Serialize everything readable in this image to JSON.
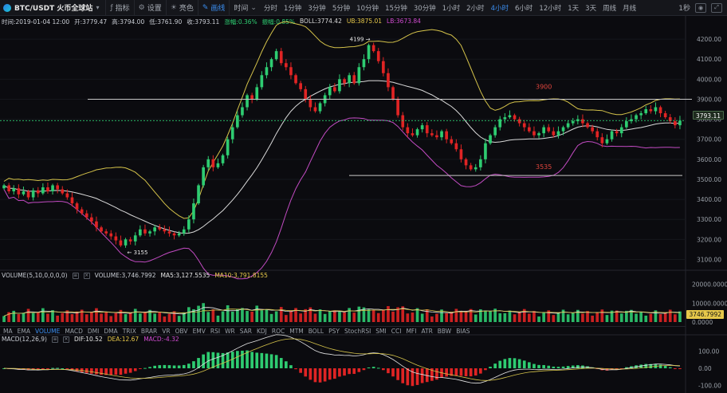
{
  "toolbar": {
    "pair": "BTC/USDT 火币全球站",
    "buttons": [
      {
        "label": "指标",
        "icon": "indicator-icon"
      },
      {
        "label": "设置",
        "icon": "gear-icon"
      },
      {
        "label": "亮色",
        "icon": "theme-icon"
      },
      {
        "label": "画线",
        "icon": "draw-line-icon",
        "active": true
      }
    ],
    "chart_type": "时间",
    "intervals": [
      "分时",
      "1分钟",
      "3分钟",
      "5分钟",
      "10分钟",
      "15分钟",
      "30分钟",
      "1小时",
      "2小时",
      "4小时",
      "6小时",
      "12小时",
      "1天",
      "3天",
      "周线",
      "月线"
    ],
    "active_interval": "4小时",
    "refresh": "1秒"
  },
  "ohlc": {
    "time": "时间:2019-01-04 12:00",
    "open": "开:3779.47",
    "high": "高:3794.00",
    "low": "低:3761.90",
    "close": "收:3793.11",
    "change": "涨幅:0.36%",
    "amp": "振幅:0.85%",
    "boll": "BOLL:3774.42",
    "ub": "UB:3875.01",
    "lb": "LB:3673.84"
  },
  "volume_legend": {
    "label": "VOLUME(5,10,0,0,0,0)",
    "vol": "VOLUME:3,746.7992",
    "ma5": "MA5:3,127.5535",
    "ma10": "MA10:3,791.8155"
  },
  "macd_legend": {
    "label": "MACD(12,26,9)",
    "dif": "DIF:10.52",
    "dea": "DEA:12.67",
    "macd": "MACD:-4.32"
  },
  "indicator_tabs": [
    "MA",
    "EMA",
    "VOLUME",
    "MACD",
    "DMI",
    "DMA",
    "TRIX",
    "BRAR",
    "VR",
    "OBV",
    "EMV",
    "RSI",
    "WR",
    "SAR",
    "KDJ",
    "ROC",
    "MTM",
    "BOLL",
    "PSY",
    "StochRSI",
    "SMI",
    "CCI",
    "MFI",
    "ATR",
    "BBW",
    "BIAS"
  ],
  "active_tab": "VOLUME",
  "price_axis": [
    "4200.00",
    "4100.00",
    "4000.00",
    "3900.00",
    "3800.00",
    "3700.00",
    "3600.00",
    "3500.00",
    "3400.00",
    "3300.00",
    "3200.00",
    "3100.00"
  ],
  "price_tag": "3793.11",
  "volume_axis": [
    "20000.0000",
    "10000.0000",
    "0.0000"
  ],
  "volume_tag": "3746.7992",
  "macd_axis": [
    "100.00",
    "0.00",
    "-100.00"
  ],
  "annotations": {
    "high_label": "4199",
    "low_label": "3155",
    "resistance_label": "3900",
    "support_label": "3535"
  },
  "colors": {
    "up": "#2ecc71",
    "down": "#e02424",
    "ub": "#d4c24a",
    "mid": "#d9d9d9",
    "lb": "#c24bc2",
    "accent": "#3b8ef0"
  },
  "chart_data": {
    "type": "candlestick",
    "symbol": "BTC/USDT",
    "interval": "4小时",
    "ylim": [
      3050,
      4260
    ],
    "closes": [
      3470,
      3440,
      3455,
      3425,
      3440,
      3410,
      3445,
      3430,
      3460,
      3440,
      3470,
      3450,
      3430,
      3410,
      3380,
      3350,
      3330,
      3310,
      3290,
      3260,
      3240,
      3230,
      3215,
      3195,
      3170,
      3200,
      3190,
      3220,
      3250,
      3230,
      3240,
      3260,
      3250,
      3240,
      3230,
      3220,
      3230,
      3250,
      3300,
      3380,
      3470,
      3560,
      3600,
      3560,
      3580,
      3620,
      3700,
      3760,
      3820,
      3860,
      3920,
      3900,
      3960,
      4020,
      4060,
      4100,
      4140,
      4080,
      4060,
      4020,
      3980,
      3950,
      3900,
      3860,
      3840,
      3880,
      3920,
      3960,
      3940,
      4000,
      3980,
      4020,
      3980,
      4060,
      4100,
      4170,
      4140,
      4090,
      4030,
      3960,
      3900,
      3820,
      3760,
      3730,
      3720,
      3750,
      3770,
      3730,
      3720,
      3710,
      3740,
      3700,
      3680,
      3650,
      3600,
      3570,
      3550,
      3560,
      3600,
      3680,
      3720,
      3760,
      3800,
      3810,
      3820,
      3800,
      3780,
      3760,
      3740,
      3720,
      3730,
      3760,
      3740,
      3720,
      3740,
      3760,
      3780,
      3790,
      3800,
      3780,
      3760,
      3740,
      3710,
      3680,
      3700,
      3740,
      3730,
      3760,
      3790,
      3800,
      3820,
      3830,
      3850,
      3840,
      3860,
      3830,
      3810,
      3790,
      3770,
      3793
    ]
  }
}
